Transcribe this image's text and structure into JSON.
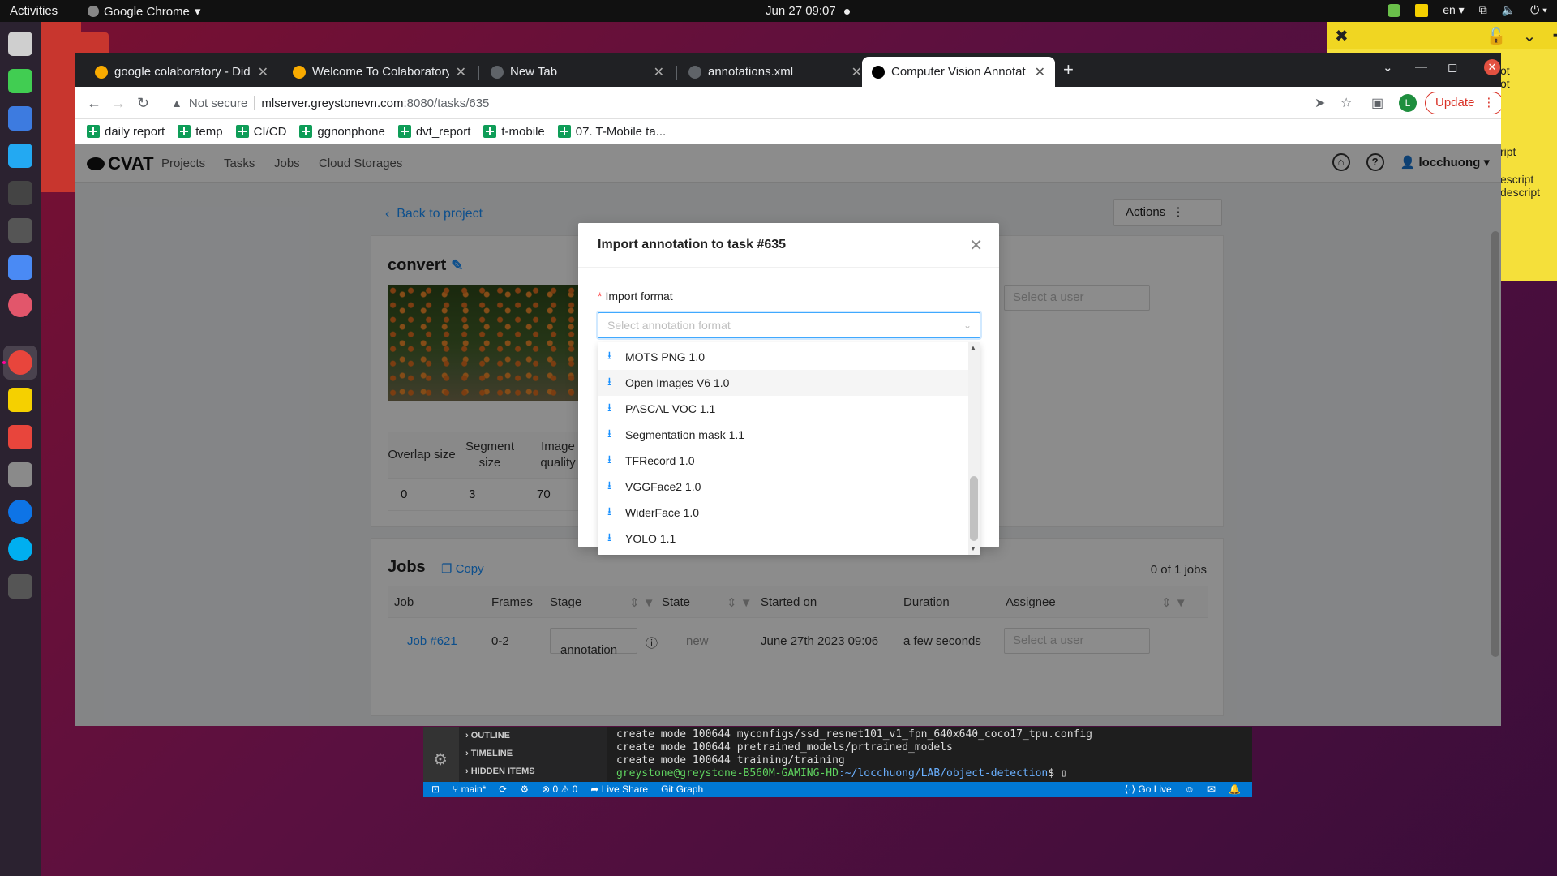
{
  "topbar": {
    "activities": "Activities",
    "app_name": "Google Chrome",
    "clock": "Jun 27  09:07",
    "lang": "en"
  },
  "tabs": [
    {
      "title": "google colaboratory - Did",
      "favicon_color": "#f9ab00"
    },
    {
      "title": "Welcome To Colaboratory",
      "favicon_color": "#f9ab00"
    },
    {
      "title": "New Tab",
      "favicon_color": "#5f6368"
    },
    {
      "title": "annotations.xml",
      "favicon_color": "#5f6368"
    },
    {
      "title": "Computer Vision Annotat",
      "favicon_color": "#000000"
    }
  ],
  "omnibar": {
    "security": "Not secure",
    "host": "mlserver.greystonevn.com",
    "path": ":8080/tasks/635",
    "profile_initial": "L",
    "update_label": "Update"
  },
  "bookmarks": [
    "daily report",
    "temp",
    "CI/CD",
    "ggnonphone",
    "dvt_report",
    "t-mobile",
    "07. T-Mobile ta..."
  ],
  "cvat": {
    "logo": "CVAT",
    "nav": [
      "Projects",
      "Tasks",
      "Jobs",
      "Cloud Storages"
    ],
    "user": "locchuong",
    "back_link": "Back to project",
    "actions_label": "Actions",
    "task_name": "convert",
    "assignee_placeholder": "Select a user",
    "params": {
      "headers": [
        "Overlap size",
        "Segment size",
        "Image quality"
      ],
      "values": [
        "0",
        "3",
        "70"
      ]
    },
    "jobs": {
      "title": "Jobs",
      "copy_label": "Copy",
      "count": "0 of 1 jobs",
      "columns": [
        "Job",
        "Frames",
        "Stage",
        "State",
        "Started on",
        "Duration",
        "Assignee"
      ],
      "row": {
        "job": "Job #621",
        "frames": "0-2",
        "stage": "annotation",
        "state": "new",
        "started": "June 27th 2023 09:06",
        "duration": "a few seconds",
        "assignee_placeholder": "Select a user"
      }
    }
  },
  "modal": {
    "title": "Import annotation to task #635",
    "field_label": "Import format",
    "select_placeholder": "Select annotation format",
    "options": [
      "MOTS PNG 1.0",
      "Open Images V6 1.0",
      "PASCAL VOC 1.1",
      "Segmentation mask 1.1",
      "TFRecord 1.0",
      "VGGFace2 1.0",
      "WiderFace 1.0",
      "YOLO 1.1"
    ],
    "hovered_option": "Open Images V6 1.0"
  },
  "vscode": {
    "panels": [
      "OUTLINE",
      "TIMELINE",
      "HIDDEN ITEMS"
    ],
    "terminal_lines": [
      "create mode 100644 myconfigs/ssd_resnet101_v1_fpn_640x640_coco17_tpu.config",
      "create mode 100644 pretrained_models/prtrained_models",
      "create mode 100644 training/training"
    ],
    "prompt_user": "greystone@greystone-B560M-GAMING-HD",
    "prompt_path": ":~/locchuong/LAB/object-detection",
    "prompt_end": "$",
    "status_branch": "main*",
    "status_errors": "0",
    "status_warnings": "0",
    "status_liveshare": "Live Share",
    "status_gitgraph": "Git Graph",
    "status_golive": "Go Live"
  },
  "yellow_note": {
    "lines": [
      "ot",
      "ot",
      "ript",
      "escript",
      "descript"
    ]
  }
}
